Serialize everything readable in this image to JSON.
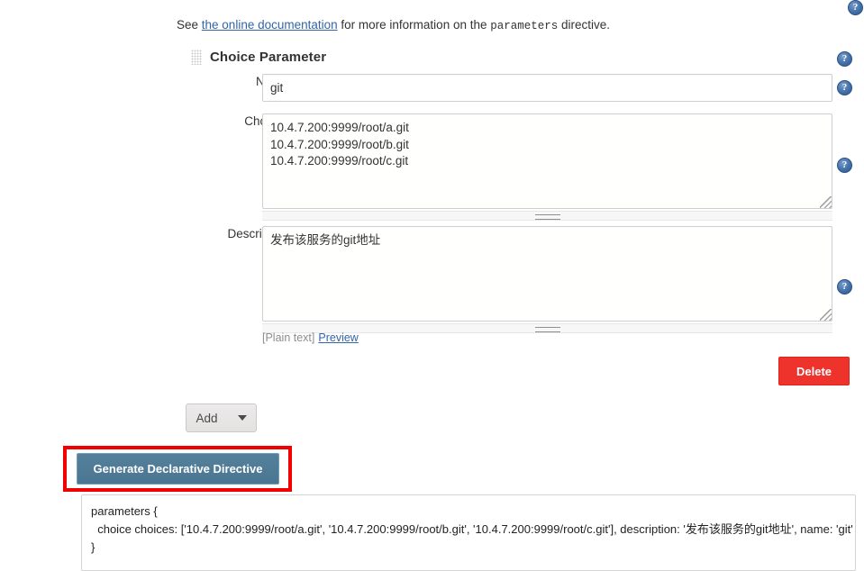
{
  "intro": {
    "before_link": "See ",
    "link_text": "the online documentation",
    "middle": " for more information on the ",
    "code_text": "parameters",
    "after_code": " directive."
  },
  "section": {
    "title": "Choice Parameter",
    "grip_icon": "drag-grip-icon"
  },
  "fields": {
    "name": {
      "label": "Name",
      "value": "git",
      "placeholder": ""
    },
    "choices": {
      "label": "Choices",
      "value": "10.4.7.200:9999/root/a.git\n10.4.7.200:9999/root/b.git\n10.4.7.200:9999/root/c.git",
      "placeholder": ""
    },
    "description": {
      "label": "Description",
      "value": "发布该服务的git地址",
      "placeholder": "",
      "plain_text_label": "[Plain text]",
      "preview_link": "Preview"
    }
  },
  "buttons": {
    "delete": "Delete",
    "add": "Add",
    "generate": "Generate Declarative Directive"
  },
  "help_icons": {
    "glyph": "?",
    "name": "help-icon"
  },
  "generated_output": {
    "value": "parameters {\n  choice choices: ['10.4.7.200:9999/root/a.git', '10.4.7.200:9999/root/b.git', '10.4.7.200:9999/root/c.git'], description: '发布该服务的git地址', name: 'git'\n}"
  },
  "colors": {
    "link": "#3465a4",
    "delete_red": "#ee322c",
    "generate_blue": "#4a7691",
    "annotation_red": "#f20000",
    "help_blue": "#4472a8"
  }
}
